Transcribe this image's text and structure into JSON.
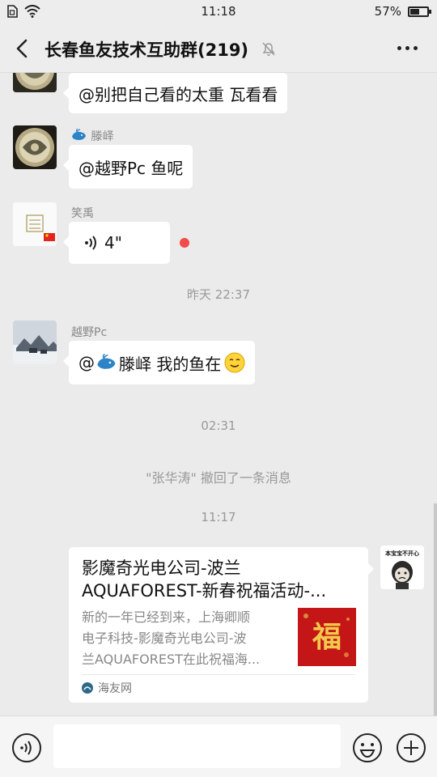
{
  "status_bar": {
    "time": "11:18",
    "battery_text": "57%",
    "battery_level": 0.57
  },
  "header": {
    "title": "长春鱼友技术互助群(219)"
  },
  "messages": [
    {
      "type": "text",
      "sender": "",
      "text": "@别把自己看的太重  瓦看看"
    },
    {
      "type": "text",
      "sender": "滕峄",
      "text": "@越野Pc  鱼呢"
    },
    {
      "type": "voice",
      "sender": "笑禹",
      "duration": "4\""
    },
    {
      "type": "time",
      "text": "昨天 22:37"
    },
    {
      "type": "text",
      "sender": "越野Pc",
      "text_prefix": "@",
      "text_mid": "滕峄  我的鱼在"
    },
    {
      "type": "time",
      "text": "02:31"
    },
    {
      "type": "system",
      "text": "\"张华涛\" 撤回了一条消息"
    },
    {
      "type": "time",
      "text": "11:17"
    }
  ],
  "link_card": {
    "title_line1": "影魔奇光电公司-波兰",
    "title_line2": "AQUAFOREST-新春祝福活动-...",
    "desc_line1": "新的一年已经到来，上海卿顺",
    "desc_line2": "电子科技-影魔奇光电公司-波",
    "desc_line3": "兰AQUAFOREST在此祝福海...",
    "thumb_char": "福",
    "source": "海友网"
  },
  "self_avatar_text": "本宝宝不开心",
  "colors": {
    "background": "#ebebeb",
    "bubble": "#ffffff",
    "unread_dot": "#f44a4a"
  }
}
